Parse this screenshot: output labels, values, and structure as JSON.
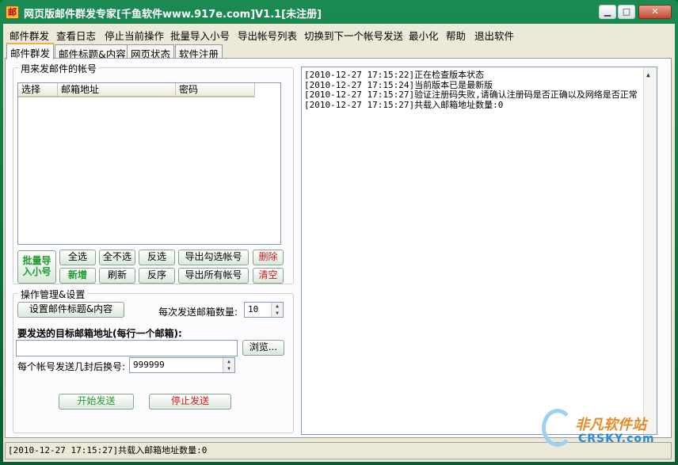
{
  "window": {
    "title": "网页版邮件群发专家[千鱼软件www.917e.com]V1.1[未注册]",
    "icon_label": "邮",
    "minimize_glyph": "▁",
    "maximize_glyph": "□",
    "close_glyph": "✕"
  },
  "menu": [
    "邮件群发",
    "查看日志",
    "停止当前操作",
    "批量导入小号",
    "导出帐号列表",
    "切换到下一个帐号发送",
    "最小化",
    "帮助",
    "退出软件"
  ],
  "tabs": [
    "邮件群发",
    "邮件标题&内容",
    "网页状态",
    "软件注册"
  ],
  "accounts_group": {
    "title": "用来发邮件的帐号",
    "columns": [
      "选择",
      "邮箱地址",
      "密码"
    ],
    "rows": []
  },
  "account_buttons": {
    "batch_import": "批量导\n入小号",
    "select_all": "全选",
    "select_none": "全不选",
    "invert": "反选",
    "export_checked": "导出勾选帐号",
    "delete": "删除",
    "add": "新增",
    "refresh": "刷新",
    "reverse_order": "反序",
    "export_all": "导出所有帐号",
    "clear": "清空"
  },
  "settings_group": {
    "title": "操作管理&设置",
    "set_subject_button": "设置邮件标题&内容",
    "per_send_label": "每次发送邮箱数量:",
    "per_send_value": "10",
    "targets_label": "要发送的目标邮箱地址(每行一个邮箱):",
    "targets_value": "",
    "browse_button": "浏览...",
    "switch_after_label": "每个帐号发送几封后换号:",
    "switch_after_value": "999999",
    "start_button": "开始发送",
    "stop_button": "停止发送"
  },
  "log": [
    "[2010-12-27 17:15:22]正在检查版本状态",
    "[2010-12-27 17:15:24]当前版本已是最新版",
    "[2010-12-27 17:15:27]验证注册码失败,请确认注册码是否正确以及网络是否正常",
    "[2010-12-27 17:15:27]共载入邮箱地址数量:0"
  ],
  "status_bar": "[2010-12-27 17:15:27]共载入邮箱地址数量:0",
  "watermark": {
    "cn": "非凡软件站",
    "en": "CRSKY.com"
  },
  "colors": {
    "title_bar": "#0b6b3a",
    "green_text": "#1d9b2b",
    "red_text": "#d01a1a",
    "face": "#ece9d8"
  }
}
